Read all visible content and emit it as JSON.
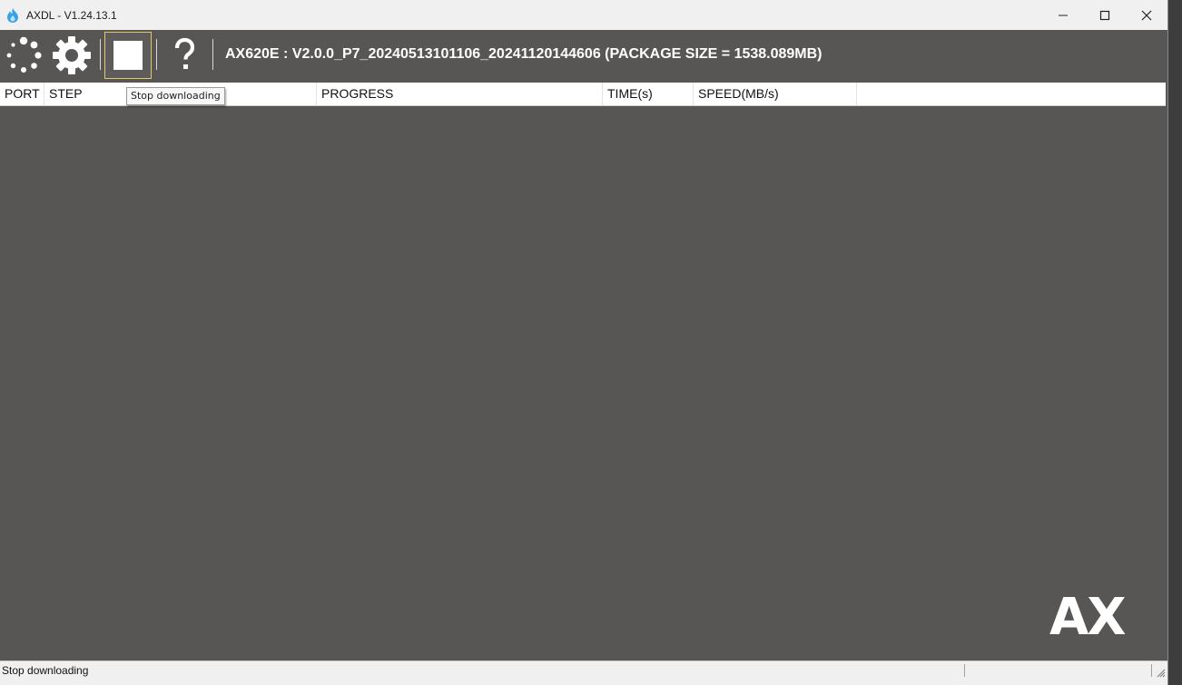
{
  "window": {
    "title": "AXDL - V1.24.13.1",
    "minimize_icon": "minimize-icon",
    "maximize_icon": "maximize-icon",
    "close_icon": "close-icon"
  },
  "toolbar": {
    "buttons": [
      {
        "name": "load-button",
        "icon": "spinner-icon"
      },
      {
        "name": "settings-button",
        "icon": "gear-icon"
      },
      {
        "name": "stop-button",
        "icon": "stop-icon"
      },
      {
        "name": "help-button",
        "icon": "question-icon"
      }
    ],
    "package_info": "AX620E : V2.0.0_P7_20240513101106_20241120144606 (PACKAGE SIZE = 1538.089MB)"
  },
  "tooltip": {
    "text": "Stop downloading"
  },
  "table": {
    "columns": [
      "PORT",
      "STEP",
      "PROGRESS",
      "TIME(s)",
      "SPEED(MB/s)"
    ]
  },
  "logo": {
    "text": "AX"
  },
  "statusbar": {
    "text": "Stop downloading"
  },
  "colors": {
    "background": "#585654",
    "toolbar_text": "#ffffff",
    "stop_highlight": "#e4c66a",
    "app_icon": "#3aa0e8"
  }
}
